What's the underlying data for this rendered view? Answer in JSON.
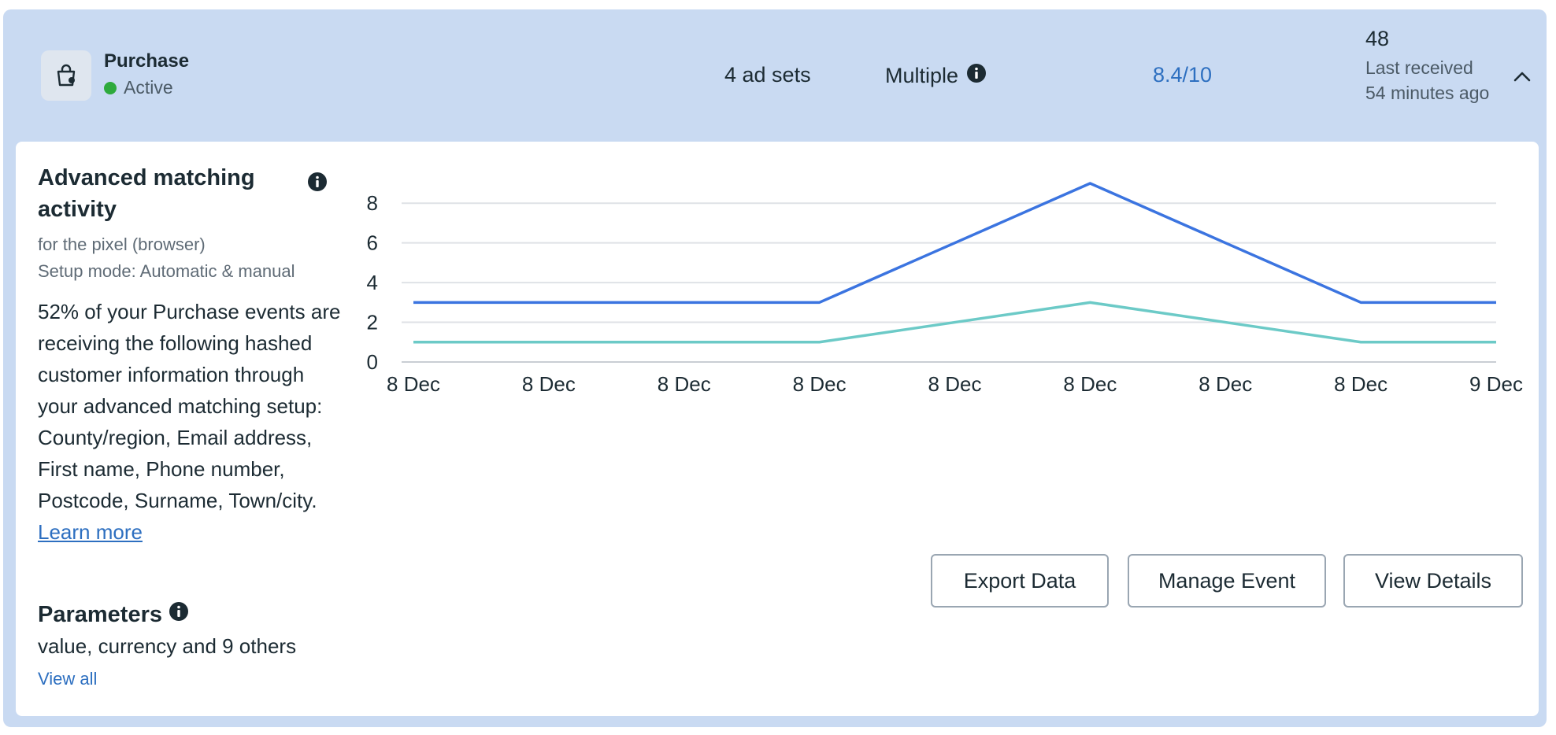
{
  "event": {
    "name": "Purchase",
    "status": "Active",
    "ad_sets": "4 ad sets",
    "integration": "Multiple",
    "score": "8.4/10",
    "count": "48",
    "last_received": "Last received 54 minutes ago"
  },
  "advanced_matching": {
    "title": "Advanced matching activity",
    "subtitle": "for the pixel (browser)",
    "setup_mode": "Setup mode: Automatic & manual",
    "description": "52% of your Purchase events are receiving the following hashed customer information through your advanced matching setup: County/region, Email address, First name, Phone number, Postcode, Surname, Town/city.",
    "learn_more": "Learn more"
  },
  "parameters": {
    "title": "Parameters",
    "text": "value, currency and 9 others",
    "view_all": "View all"
  },
  "buttons": {
    "export": "Export Data",
    "manage": "Manage Event",
    "view": "View Details"
  },
  "icons": [
    "shopping-bag-icon",
    "info-icon",
    "chevron-up-icon"
  ],
  "colors": {
    "accent": "#2d6fc0",
    "active": "#2eaa3d",
    "series_1": "#3b74e0",
    "series_2": "#6ccac7"
  },
  "chart_data": {
    "type": "line",
    "categories": [
      "8 Dec",
      "8 Dec",
      "8 Dec",
      "8 Dec",
      "8 Dec",
      "8 Dec",
      "8 Dec",
      "8 Dec",
      "9 Dec"
    ],
    "series": [
      {
        "values": [
          3,
          3,
          3,
          3,
          6,
          9,
          6,
          3,
          3
        ],
        "color": "#3b74e0"
      },
      {
        "values": [
          1,
          1,
          1,
          1,
          2,
          3,
          2,
          1,
          1
        ],
        "color": "#6ccac7"
      }
    ],
    "yticks": [
      0,
      2,
      4,
      6,
      8
    ],
    "ylim": [
      0,
      9
    ],
    "grid": true
  }
}
